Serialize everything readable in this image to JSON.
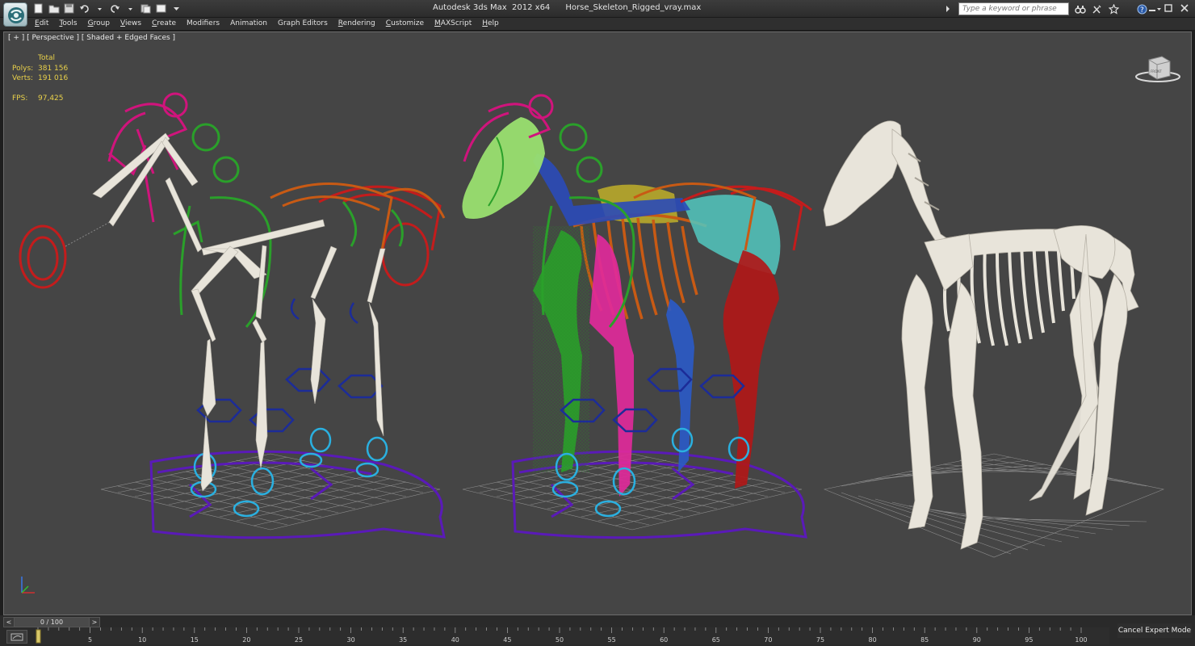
{
  "title_bar": {
    "window_title": "Autodesk 3ds Max  2012 x64      Horse_Skeleton_Rigged_vray.max",
    "search_placeholder": "Type a keyword or phrase",
    "quick_access_icons": [
      "new-file-icon",
      "open-file-icon",
      "save-icon",
      "undo-icon",
      "undo-dropdown-icon",
      "redo-icon",
      "redo-dropdown-icon",
      "project-folder-icon",
      "window-crossing-icon",
      "customize-dropdown-icon"
    ],
    "info_icons": [
      "search-arrow-icon",
      "binoculars-icon",
      "tools-icon",
      "favorites-star-icon",
      "help-icon"
    ]
  },
  "menu": {
    "items": [
      "Edit",
      "Tools",
      "Group",
      "Views",
      "Create",
      "Modifiers",
      "Animation",
      "Graph Editors",
      "Rendering",
      "Customize",
      "MAXScript",
      "Help"
    ]
  },
  "viewport": {
    "label": "[ + ] [ Perspective ] [ Shaded + Edged Faces ]",
    "stats": {
      "total_label": "Total",
      "polys_label": "Polys:",
      "polys_value": "381 156",
      "verts_label": "Verts:",
      "verts_value": "191 016",
      "fps_label": "FPS:",
      "fps_value": "97,425"
    },
    "viewcube_label": "FRONT"
  },
  "timeline": {
    "slider_value": "0 / 100",
    "ticks": [
      "5",
      "10",
      "15",
      "20",
      "25",
      "30",
      "35",
      "40",
      "45",
      "50",
      "55",
      "60",
      "65",
      "70",
      "75",
      "80",
      "85",
      "90",
      "95",
      "100"
    ],
    "cancel_expert_label": "Cancel Expert Mode"
  },
  "colors": {
    "viewport_bg": "#454545",
    "rig_magenta": "#d0147c",
    "rig_green": "#2aa02a",
    "rig_red": "#c41c1c",
    "rig_orange": "#c85a14",
    "rig_blue": "#1c3ca8",
    "rig_cyan": "#2ab0e0",
    "rig_purple": "#5a1ab8",
    "bone_white": "#e8e4da",
    "stat_yellow": "#e8d04a"
  }
}
